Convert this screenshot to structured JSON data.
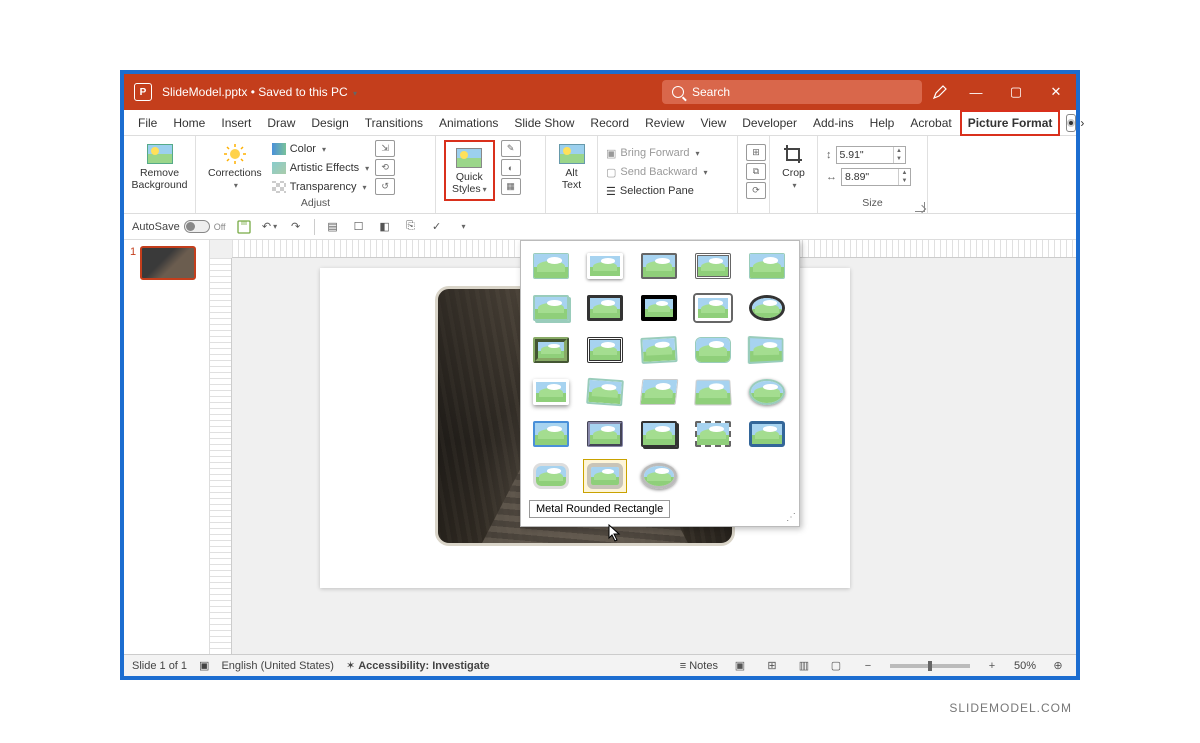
{
  "titlebar": {
    "app_letter": "P",
    "filename": "SlideModel.pptx",
    "save_status": "Saved to this PC",
    "search_placeholder": "Search"
  },
  "win": {
    "min": "—",
    "max": "▢",
    "close": "✕"
  },
  "tabs": {
    "file": "File",
    "home": "Home",
    "insert": "Insert",
    "draw": "Draw",
    "design": "Design",
    "transitions": "Transitions",
    "animations": "Animations",
    "slideshow": "Slide Show",
    "record": "Record",
    "review": "Review",
    "view": "View",
    "developer": "Developer",
    "addins": "Add-ins",
    "help": "Help",
    "acrobat": "Acrobat",
    "picture_format": "Picture Format"
  },
  "ribbon": {
    "remove_bg": "Remove\nBackground",
    "corrections": "Corrections",
    "color": "Color",
    "artistic": "Artistic Effects",
    "transparency": "Transparency",
    "adjust_label": "Adjust",
    "quick_styles": "Quick\nStyles",
    "alt_text": "Alt\nText",
    "bring_forward": "Bring Forward",
    "send_backward": "Send Backward",
    "selection_pane": "Selection Pane",
    "crop": "Crop",
    "size_label": "Size",
    "height_value": "5.91\"",
    "width_value": "8.89\""
  },
  "qat": {
    "autosave": "AutoSave",
    "off": "Off"
  },
  "gallery": {
    "tooltip": "Metal Rounded Rectangle",
    "hover_row": 5,
    "hover_col": 1
  },
  "thumb": {
    "number": "1"
  },
  "statusbar": {
    "slide_of": "Slide 1 of 1",
    "language": "English (United States)",
    "accessibility": "Accessibility: Investigate",
    "notes": "Notes",
    "zoom": "50%"
  },
  "attribution": "SLIDEMODEL.COM"
}
